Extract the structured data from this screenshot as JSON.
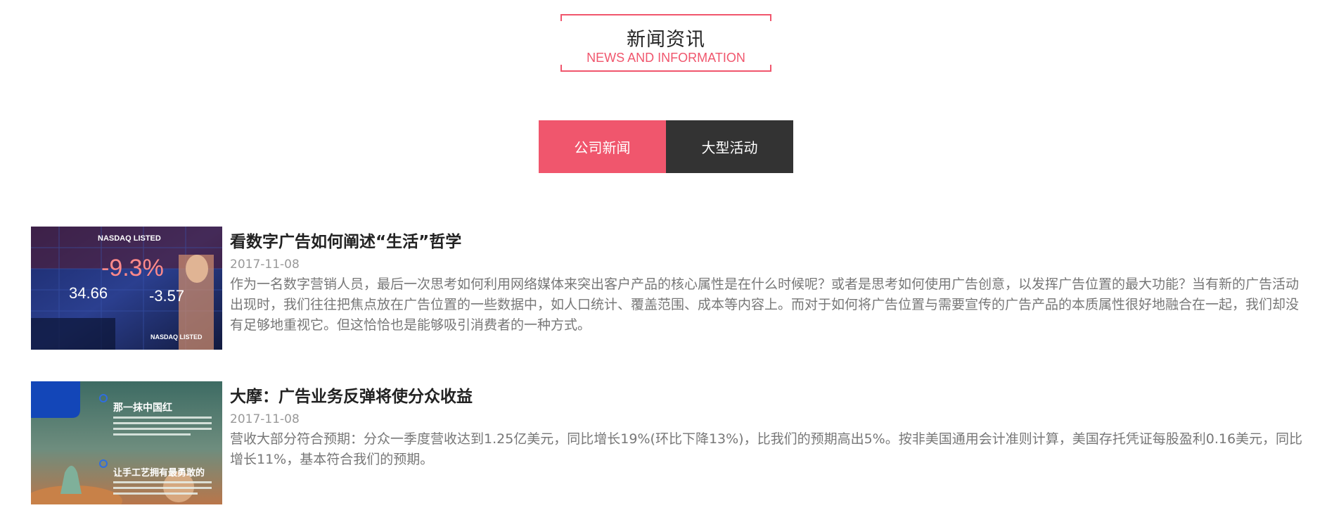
{
  "heading": {
    "title": "新闻资讯",
    "subtitle": "NEWS AND INFORMATION"
  },
  "tabs": [
    {
      "label": "公司新闻",
      "active": true
    },
    {
      "label": "大型活动",
      "active": false
    }
  ],
  "news": [
    {
      "title": "看数字广告如何阐述“生活”哲学",
      "date": "2017-11-08",
      "summary": "作为一名数字营销人员，最后一次思考如何利用网络媒体来突出客户产品的核心属性是在什么时候呢？或者是思考如何使用广告创意，以发挥广告位置的最大功能？当有新的广告活动出现时，我们往往把焦点放在广告位置的一些数据中，如人口统计、覆盖范围、成本等内容上。而对于如何将广告位置与需要宣传的广告产品的本质属性很好地融合在一起，我们却没有足够地重视它。但这恰恰也是能够吸引消费者的一种方式。",
      "image": {
        "texts": [
          "NASDAQ LISTED",
          "-9.3%",
          "34.66",
          "-3.57",
          "NASDAQ LISTED"
        ]
      }
    },
    {
      "title": "大摩：广告业务反弹将使分众收益",
      "date": "2017-11-08",
      "summary": "营收大部分符合预期：分众一季度营收达到1.25亿美元，同比增长19%(环比下降13%)，比我们的预期高出5%。按非美国通用会计准则计算，美国存托凭证每股盈利0.16美元，同比增长11%，基本符合我们的预期。",
      "image": {
        "texts": [
          "那一抹中国红",
          "让手工艺拥有最勇敢的"
        ]
      }
    }
  ],
  "colors": {
    "accent": "#f0566d",
    "dark_tab": "#333333",
    "title": "#222222",
    "muted": "#999999",
    "body": "#777777"
  }
}
